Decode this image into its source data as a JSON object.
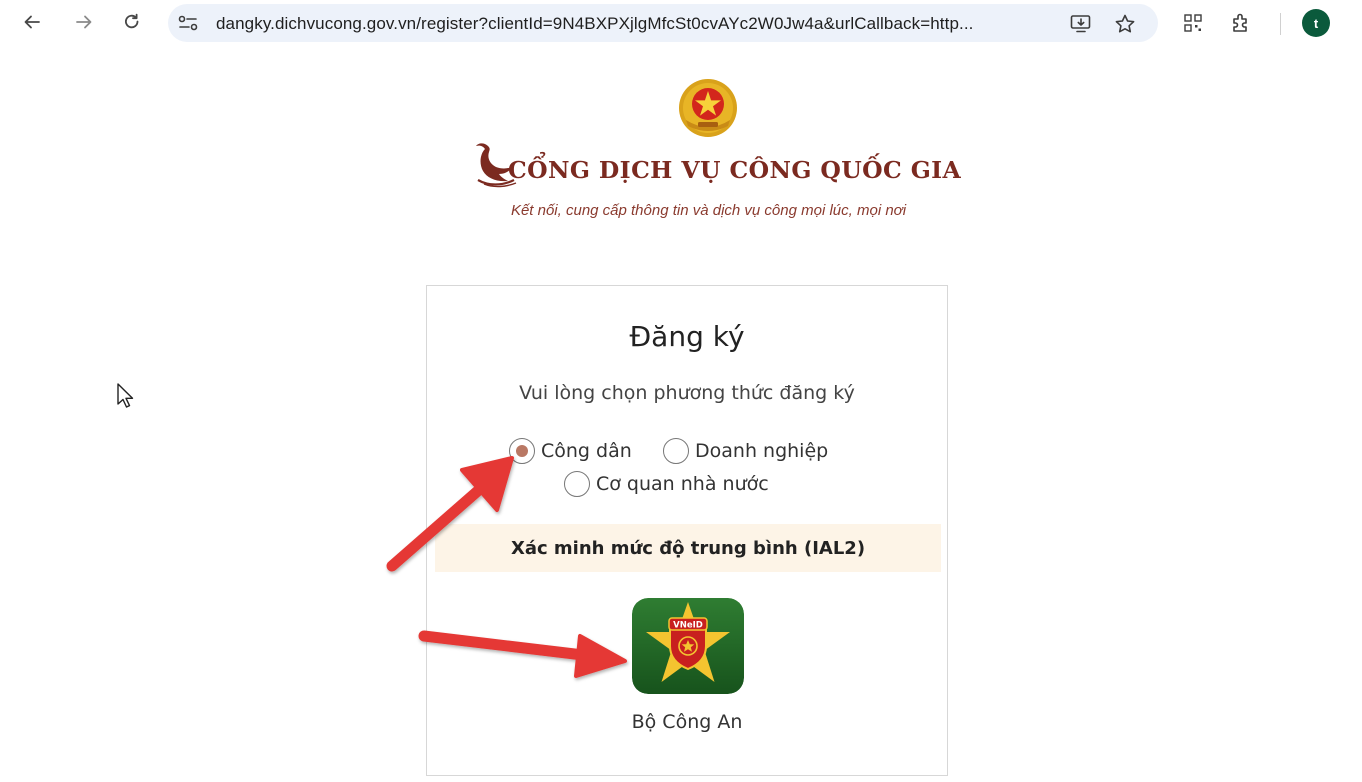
{
  "browser": {
    "url": "dangky.dichvucong.gov.vn/register?clientId=9N4BXPXjlgMfcSt0cvAYc2W0Jw4a&urlCallback=http...",
    "profile_initial": "t",
    "icons": [
      "back-arrow-icon",
      "forward-arrow-icon",
      "reload-icon",
      "site-info-icon",
      "install-app-icon",
      "bookmark-star-icon",
      "qr-code-icon",
      "extensions-icon"
    ]
  },
  "header": {
    "portal_title": "CỔNG DỊCH VỤ CÔNG QUỐC GIA",
    "slogan": "Kết nối, cung cấp thông tin và dịch vụ công mọi lúc, mọi nơi"
  },
  "register": {
    "title": "Đăng ký",
    "subtitle": "Vui lòng chọn phương thức đăng ký",
    "options": [
      {
        "label": "Công dân",
        "checked": true
      },
      {
        "label": "Doanh nghiệp",
        "checked": false
      },
      {
        "label": "Cơ quan nhà nước",
        "checked": false
      }
    ],
    "verification_level": "Xác minh mức độ trung bình (IAL2)",
    "provider": {
      "badge_text": "VNeID",
      "label": "Bộ Công An"
    }
  },
  "colors": {
    "brand_red": "#7b2a20",
    "radio_dot": "#b97864",
    "ial_bar_bg": "#fdf4e7",
    "arrow_red": "#e53935",
    "vneid_green": "#1f6b2a"
  }
}
